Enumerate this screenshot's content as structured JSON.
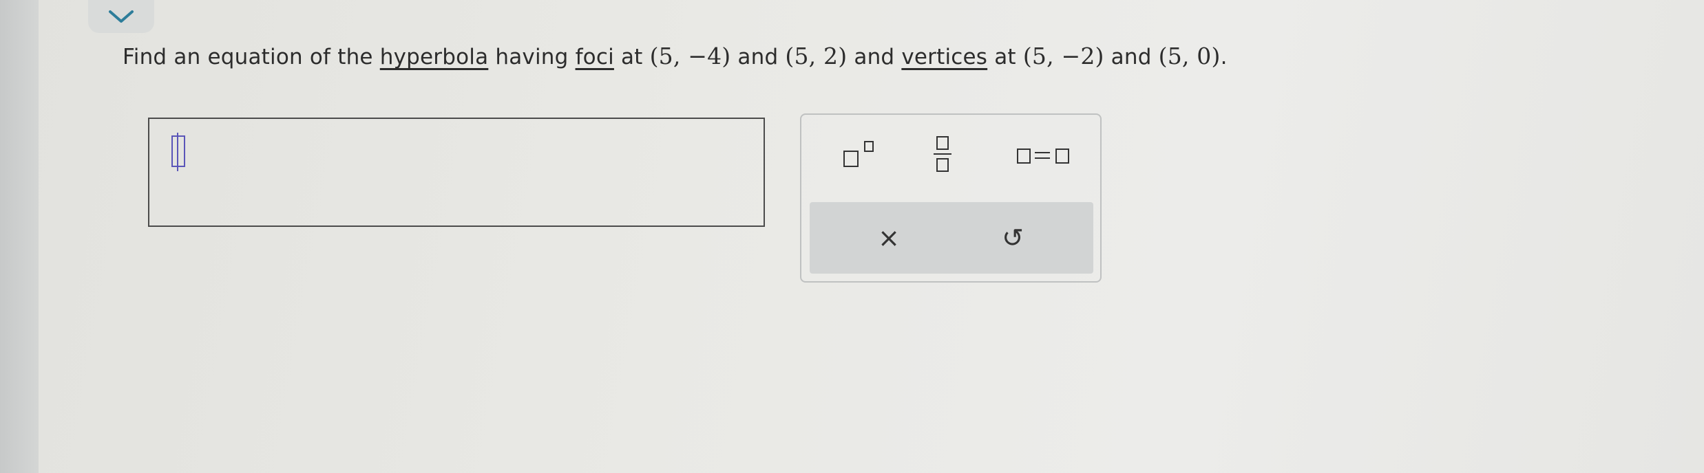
{
  "question": {
    "p1": "Find an equation of the ",
    "link1": "hyperbola",
    "p2": " having ",
    "link2": "foci",
    "p3": " at ",
    "m1": "(5, −4)",
    "p4": " and ",
    "m2": "(5, 2)",
    "p5": " and ",
    "link3": "vertices",
    "p6": " at ",
    "m3": "(5, −2)",
    "p7": " and ",
    "m4": "(5, 0)",
    "p8": "."
  },
  "palette": {
    "buttons": [
      "superscript-button",
      "fraction-button",
      "equation-button"
    ],
    "clear_label": "×",
    "undo_label": "↺"
  },
  "icons": {
    "collapse": "chevron-down-icon",
    "clear": "close-icon",
    "undo": "undo-icon"
  },
  "colors": {
    "cursor": "#5a55b8",
    "accent": "#2d7d9a"
  }
}
